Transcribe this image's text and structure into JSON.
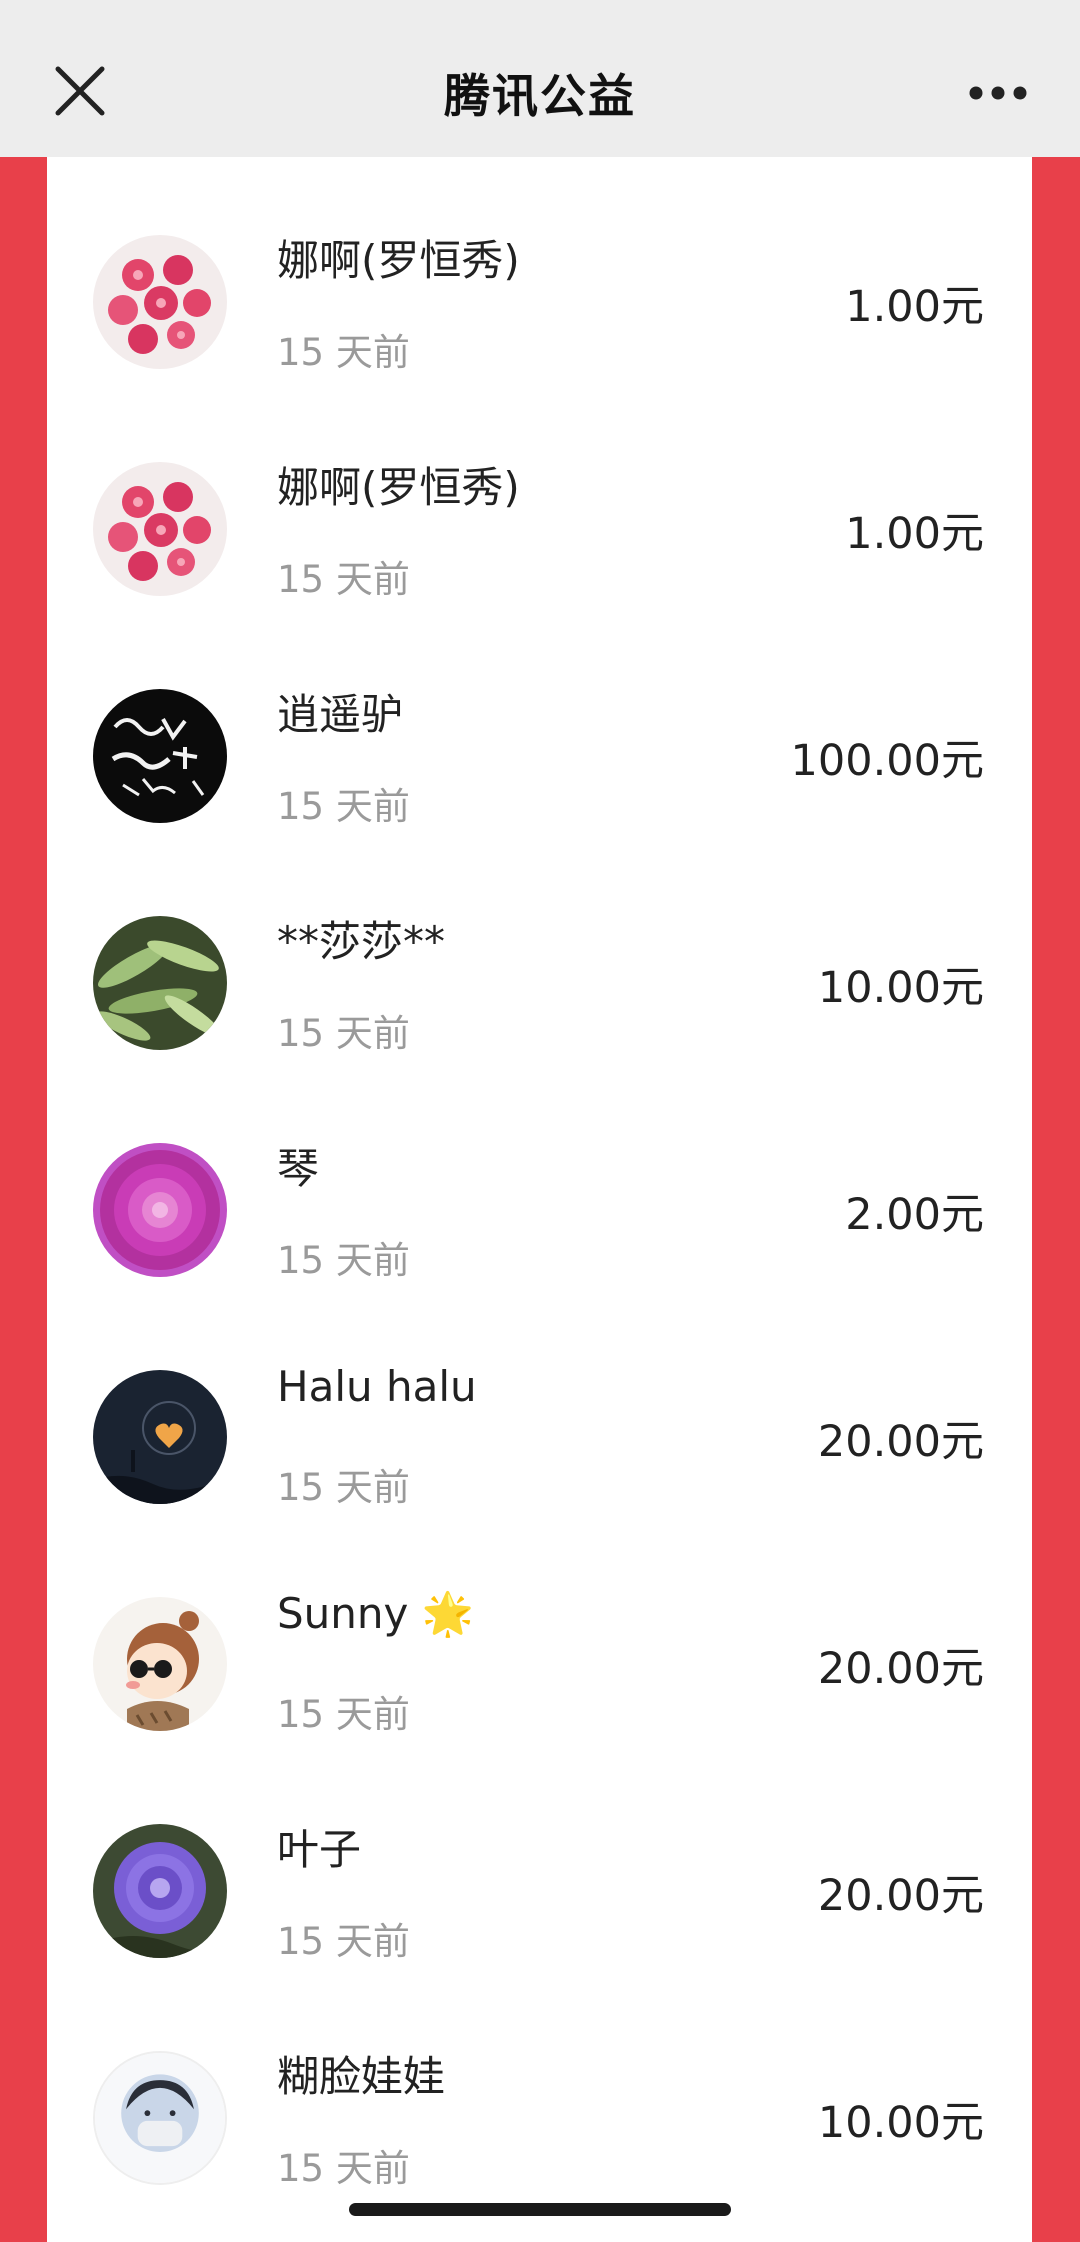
{
  "header": {
    "title": "腾讯公益",
    "close_icon": "close-icon",
    "more_icon": "more-dots-icon"
  },
  "colors": {
    "accent_red": "#e8404a",
    "header_bg": "#ededed",
    "text_primary": "#222222",
    "text_secondary": "#9a9a9a"
  },
  "donations": [
    {
      "name": "娜啊(罗恒秀)",
      "time": "15 天前",
      "amount": "1.00元",
      "avatar": "pink-flowers-avatar"
    },
    {
      "name": "娜啊(罗恒秀)",
      "time": "15 天前",
      "amount": "1.00元",
      "avatar": "pink-flowers-avatar"
    },
    {
      "name": "逍遥驴",
      "time": "15 天前",
      "amount": "100.00元",
      "avatar": "calligraphy-avatar"
    },
    {
      "name": "**莎莎**",
      "time": "15 天前",
      "amount": "10.00元",
      "avatar": "fern-avatar"
    },
    {
      "name": "琴",
      "time": "15 天前",
      "amount": "2.00元",
      "avatar": "purple-dahlia-avatar"
    },
    {
      "name": "Halu halu",
      "time": "15 天前",
      "amount": "20.00元",
      "avatar": "moon-heart-avatar"
    },
    {
      "name": "Sunny 🌟",
      "time": "15 天前",
      "amount": "20.00元",
      "avatar": "cartoon-girl-avatar"
    },
    {
      "name": "叶子",
      "time": "15 天前",
      "amount": "20.00元",
      "avatar": "purple-flower-avatar"
    },
    {
      "name": "糊脸娃娃",
      "time": "15 天前",
      "amount": "10.00元",
      "avatar": "masked-person-avatar"
    }
  ]
}
